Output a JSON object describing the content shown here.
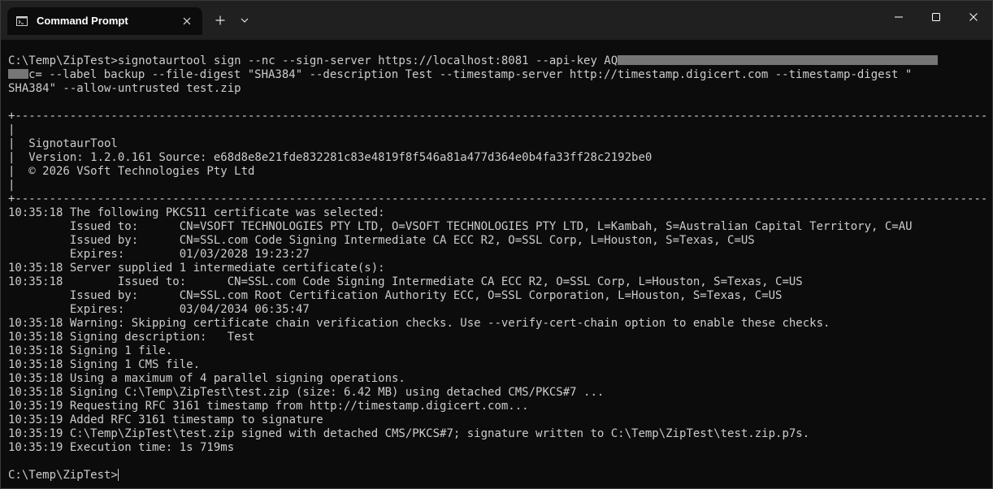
{
  "window": {
    "tab_title": "Command Prompt",
    "icons": {
      "tab_icon": "terminal-icon",
      "tab_close": "close-icon",
      "new_tab": "plus-icon",
      "dropdown": "chevron-down-icon",
      "minimize": "minimize-icon",
      "maximize": "maximize-icon",
      "close": "close-icon"
    }
  },
  "terminal": {
    "command_line_1_pre": "C:\\Temp\\ZipTest>signotaurtool sign --nc --sign-server https://localhost:8081 --api-key AQ",
    "command_line_2_post": "c= --label backup --file-digest \"SHA384\" --description Test --timestamp-server http://timestamp.digicert.com --timestamp-digest \"",
    "command_line_3": "SHA384\" --allow-untrusted test.zip",
    "lines": [
      "",
      "+------------------------------------------------------------------------------------------------------------------------------------------------------------------------+",
      "|                                                                                                                                                                        |",
      "|  SignotaurTool                                                                                                                                                         |",
      "|  Version: 1.2.0.161 Source: e68d8e8e21fde832281c83e4819f8f546a81a477d364e0b4fa33ff28c2192be0                                                                         |",
      "|  © 2026 VSoft Technologies Pty Ltd                                                                                                                                    |",
      "|                                                                                                                                                                        |",
      "+------------------------------------------------------------------------------------------------------------------------------------------------------------------------+",
      "10:35:18 The following PKCS11 certificate was selected:",
      "         Issued to:      CN=VSOFT TECHNOLOGIES PTY LTD, O=VSOFT TECHNOLOGIES PTY LTD, L=Kambah, S=Australian Capital Territory, C=AU",
      "         Issued by:      CN=SSL.com Code Signing Intermediate CA ECC R2, O=SSL Corp, L=Houston, S=Texas, C=US",
      "         Expires:        01/03/2028 19:23:27",
      "10:35:18 Server supplied 1 intermediate certificate(s):",
      "10:35:18        Issued to:      CN=SSL.com Code Signing Intermediate CA ECC R2, O=SSL Corp, L=Houston, S=Texas, C=US",
      "         Issued by:      CN=SSL.com Root Certification Authority ECC, O=SSL Corporation, L=Houston, S=Texas, C=US",
      "         Expires:        03/04/2034 06:35:47",
      "10:35:18 Warning: Skipping certificate chain verification checks. Use --verify-cert-chain option to enable these checks.",
      "10:35:18 Signing description:   Test",
      "10:35:18 Signing 1 file.",
      "10:35:18 Signing 1 CMS file.",
      "10:35:18 Using a maximum of 4 parallel signing operations.",
      "10:35:18 Signing C:\\Temp\\ZipTest\\test.zip (size: 6.42 MB) using detached CMS/PKCS#7 ...",
      "10:35:19 Requesting RFC 3161 timestamp from http://timestamp.digicert.com...",
      "10:35:19 Added RFC 3161 timestamp to signature",
      "10:35:19 C:\\Temp\\ZipTest\\test.zip signed with detached CMS/PKCS#7; signature written to C:\\Temp\\ZipTest\\test.zip.p7s.",
      "10:35:19 Execution time: 1s 719ms",
      ""
    ],
    "prompt": "C:\\Temp\\ZipTest>"
  }
}
